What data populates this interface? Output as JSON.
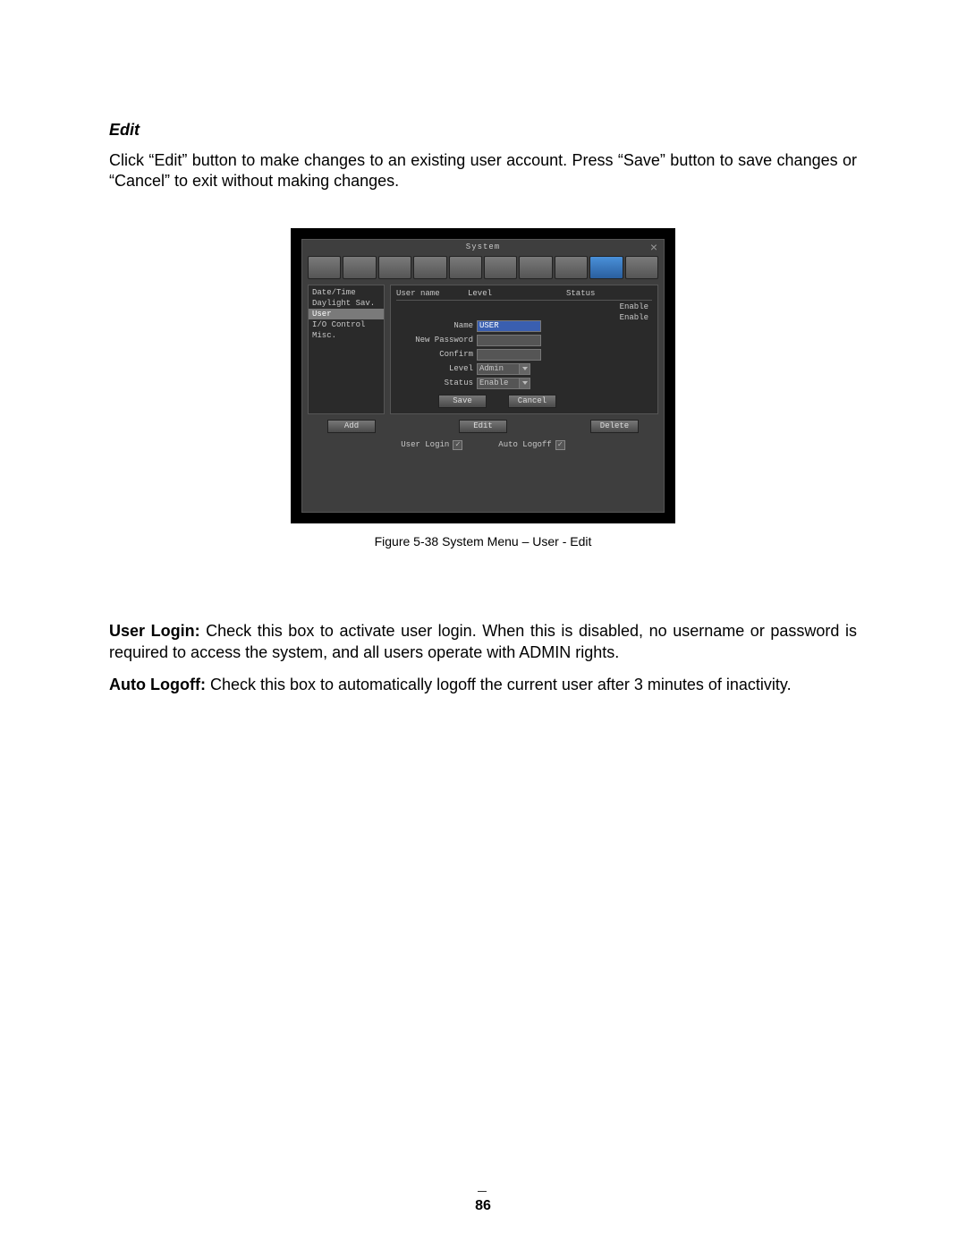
{
  "section": {
    "title": "Edit",
    "intro": "Click “Edit” button to make changes to an existing user account. Press “Save” button to save changes or “Cancel” to exit without making changes."
  },
  "figure": {
    "window_title": "System",
    "close_glyph": "×",
    "sidebar": {
      "items": [
        "Date/Time",
        "Daylight Sav.",
        "User",
        "I/O Control",
        "Misc."
      ],
      "selected_index": 2
    },
    "list_header": {
      "c1": "User name",
      "c2": "Level",
      "c3": "Status"
    },
    "status_values": [
      "Enable",
      "Enable"
    ],
    "form": {
      "name_label": "Name",
      "name_value": "USER",
      "newpw_label": "New Password",
      "confirm_label": "Confirm",
      "level_label": "Level",
      "level_value": "Admin",
      "status_label": "Status",
      "status_value": "Enable",
      "save_btn": "Save",
      "cancel_btn": "Cancel"
    },
    "footer": {
      "add_btn": "Add",
      "edit_btn": "Edit",
      "delete_btn": "Delete",
      "user_login_label": "User Login",
      "auto_logoff_label": "Auto Logoff"
    },
    "caption": "Figure 5-38 System Menu – User - Edit"
  },
  "descriptions": {
    "user_login_bold": "User Login:",
    "user_login_text": " Check this box to activate user login. When this is disabled, no username or password is required to access the system, and all users operate with ADMIN rights.",
    "auto_logoff_bold": "Auto Logoff:",
    "auto_logoff_text": " Check this box to automatically logoff the current user after 3 minutes of inactivity."
  },
  "page_number": "86"
}
